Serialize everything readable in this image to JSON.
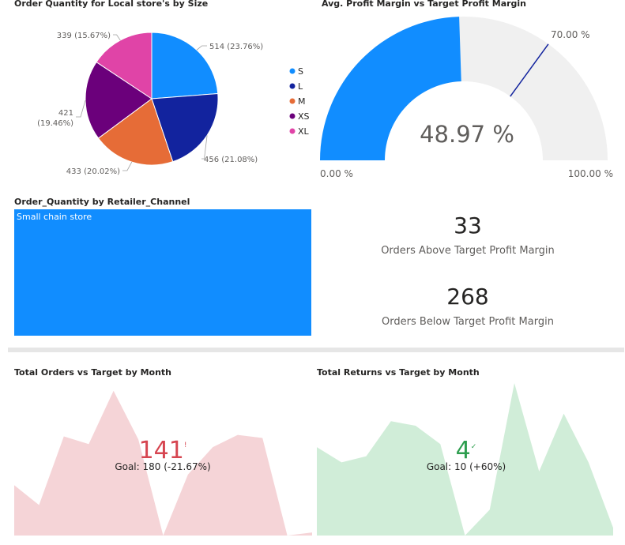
{
  "chart_data": [
    {
      "type": "pie",
      "title": "Order Quantity for Local store's by Size",
      "slices": [
        {
          "label": "S",
          "value": 514,
          "pct_label": "514 (23.76%)",
          "color": "#118DFF"
        },
        {
          "label": "L",
          "value": 456,
          "pct_label": "456 (21.08%)",
          "color": "#12239E"
        },
        {
          "label": "M",
          "value": 433,
          "pct_label": "433 (20.02%)",
          "color": "#E66C37"
        },
        {
          "label": "XS",
          "value": 421,
          "pct_label": "421 (19.46%)",
          "pct_label_line1": "421",
          "pct_label_line2": "(19.46%)",
          "color": "#6B007B"
        },
        {
          "label": "XL",
          "value": 339,
          "pct_label": "339 (15.67%)",
          "color": "#E044A7"
        }
      ],
      "legend_position": "right"
    },
    {
      "type": "gauge",
      "title": "Avg. Profit Margin vs Target Profit Margin",
      "value": 48.97,
      "value_label": "48.97 %",
      "min": 0,
      "max": 100,
      "min_label": "0.00 %",
      "max_label": "100.00 %",
      "target": 70,
      "target_label": "70.00 %",
      "fill_color": "#118DFF",
      "track_color": "#F0F0F0",
      "target_color": "#12239E"
    },
    {
      "type": "treemap",
      "title": "Order_Quantity by Retailer_Channel",
      "items": [
        {
          "label": "Small chain store",
          "color": "#118DFF"
        }
      ]
    },
    {
      "type": "area",
      "title": "Total Orders vs Target by Month",
      "values": [
        33,
        20,
        65,
        60,
        95,
        63,
        0,
        40,
        58,
        66,
        64,
        0,
        2
      ],
      "ylim": [
        0,
        100
      ],
      "kpi_value": "141",
      "kpi_indicator": "!",
      "goal_label": "Goal: 180 (-21.67%)",
      "fill_color": "#F5D4D7",
      "kpi_color": "#D64550"
    },
    {
      "type": "area",
      "title": "Total Returns vs Target by Month",
      "values": [
        58,
        48,
        52,
        75,
        72,
        60,
        0,
        17,
        100,
        42,
        80,
        48,
        5
      ],
      "ylim": [
        0,
        100
      ],
      "kpi_value": "4",
      "kpi_indicator": "✓",
      "goal_label": "Goal: 10 (+60%)",
      "fill_color": "#D0EDD8",
      "kpi_color": "#2E9E4F"
    }
  ],
  "cards": {
    "above": {
      "value": "33",
      "label": "Orders Above Target Profit Margin"
    },
    "below": {
      "value": "268",
      "label": "Orders Below Target Profit Margin"
    }
  }
}
